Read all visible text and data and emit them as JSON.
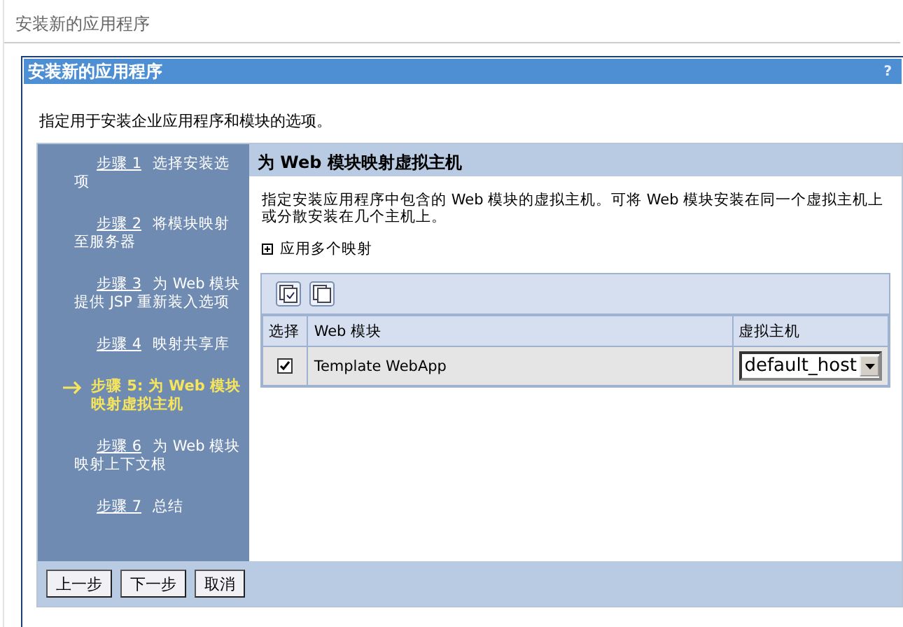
{
  "page_title": "安装新的应用程序",
  "panel": {
    "title": "安装新的应用程序",
    "help": "?",
    "description": "指定用于安装企业应用程序和模块的选项。"
  },
  "steps": [
    {
      "link": "步骤 1",
      "text": "选择安装选项",
      "selected": false
    },
    {
      "link": "步骤 2",
      "text": "将模块映射至服务器",
      "selected": false
    },
    {
      "link": "步骤 3",
      "text": "为 Web 模块提供 JSP 重新装入选项",
      "selected": false
    },
    {
      "link": "步骤 4",
      "text": "映射共享库",
      "selected": false
    },
    {
      "link": "步骤 5:",
      "text": "为 Web 模块映射虚拟主机",
      "selected": true
    },
    {
      "link": "步骤 6",
      "text": "为 Web 模块映射上下文根",
      "selected": false
    },
    {
      "link": "步骤 7",
      "text": "总结",
      "selected": false
    }
  ],
  "content": {
    "title": "为 Web 模块映射虚拟主机",
    "description": "指定安装应用程序中包含的 Web 模块的虚拟主机。可将 Web 模块安装在同一个虚拟主机上或分散安装在几个主机上。",
    "expander": {
      "label": "应用多个映射",
      "expanded": false
    }
  },
  "table": {
    "columns": [
      "选择",
      "Web 模块",
      "虚拟主机"
    ],
    "rows": [
      {
        "checked": true,
        "module": "Template WebApp",
        "host": "default_host"
      }
    ]
  },
  "buttons": [
    "上一步",
    "下一步",
    "取消"
  ]
}
